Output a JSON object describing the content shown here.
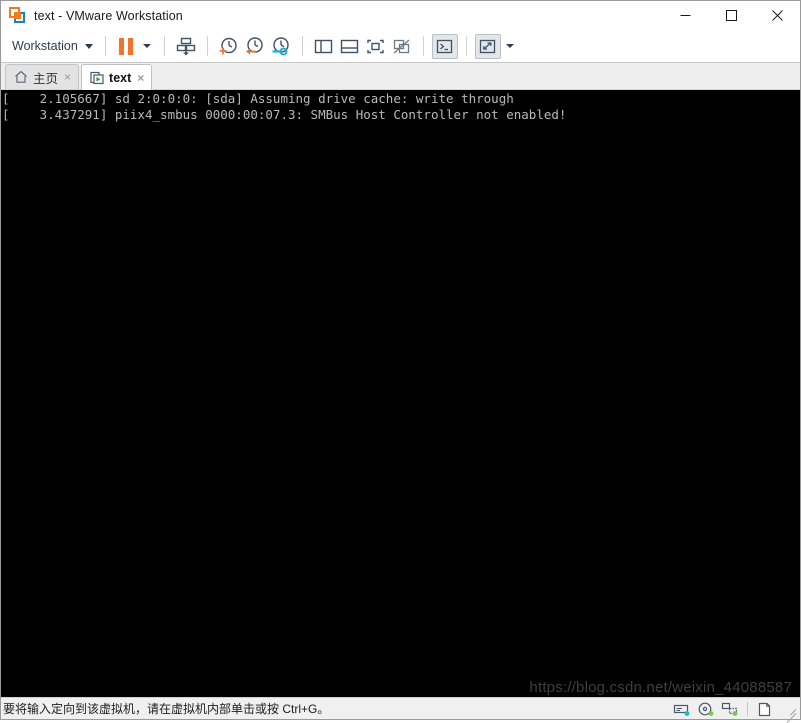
{
  "window": {
    "title": "text - VMware Workstation",
    "logo_icon": "vmware-logo-icon",
    "controls": {
      "minimize": "minimize-icon",
      "maximize": "maximize-icon",
      "close": "close-icon"
    }
  },
  "toolbar": {
    "menu_label": "Workstation",
    "menu_caret_icon": "chevron-down-icon",
    "items": [
      {
        "name": "pause-vm-button",
        "icon": "pause-icon",
        "label": ""
      },
      {
        "name": "pause-dropdown-button",
        "icon": "chevron-down-icon",
        "label": ""
      },
      {
        "name": "send-to-server-button",
        "icon": "deploy-boxes-down-arrow-icon",
        "label": ""
      },
      {
        "name": "take-snapshot-button",
        "icon": "clock-plus-icon",
        "label": ""
      },
      {
        "name": "revert-snapshot-button",
        "icon": "clock-back-arrow-icon",
        "label": ""
      },
      {
        "name": "manage-snapshots-button",
        "icon": "clock-wrench-icon",
        "label": ""
      },
      {
        "name": "show-library-button",
        "icon": "panel-left-split-icon",
        "label": ""
      },
      {
        "name": "show-thumbnails-button",
        "icon": "panel-bottom-split-icon",
        "label": ""
      },
      {
        "name": "enter-fullscreen-button",
        "icon": "fullscreen-brackets-icon",
        "label": ""
      },
      {
        "name": "unity-mode-button",
        "icon": "unity-mode-disabled-icon",
        "label": ""
      },
      {
        "name": "console-view-button",
        "icon": "terminal-prompt-icon",
        "label": ""
      },
      {
        "name": "stretch-view-button",
        "icon": "diagonal-arrows-expand-icon",
        "label": ""
      },
      {
        "name": "stretch-dropdown-button",
        "icon": "chevron-down-icon",
        "label": ""
      }
    ]
  },
  "tabs": [
    {
      "label": "主页",
      "icon": "home-icon",
      "close_icon": "×",
      "active": false
    },
    {
      "label": "text",
      "icon": "vm-play-icon",
      "close_icon": "×",
      "active": true
    }
  ],
  "console": {
    "background": "#000000",
    "text_color": "#b9b9b9",
    "lines": [
      "[    2.105667] sd 2:0:0:0: [sda] Assuming drive cache: write through",
      "[    3.437291] piix4_smbus 0000:00:07.3: SMBus Host Controller not enabled!"
    ],
    "watermark": "https://blog.csdn.net/weixin_44088587"
  },
  "statusbar": {
    "message": "要将输入定向到该虚拟机，请在虚拟机内部单击或按 Ctrl+G。",
    "devices": [
      {
        "name": "hard-disk-device-icon",
        "label": ""
      },
      {
        "name": "cd-dvd-device-icon",
        "label": ""
      },
      {
        "name": "network-adapter-device-icon",
        "label": ""
      },
      {
        "name": "printer-device-icon",
        "label": ""
      }
    ],
    "resize_grip_icon": "resize-grip-icon"
  },
  "colors": {
    "accent_orange": "#f3722c",
    "accent_blue": "#1b7fc4",
    "icon_slate": "#3f5266",
    "chrome_gray": "#eeeeee"
  }
}
